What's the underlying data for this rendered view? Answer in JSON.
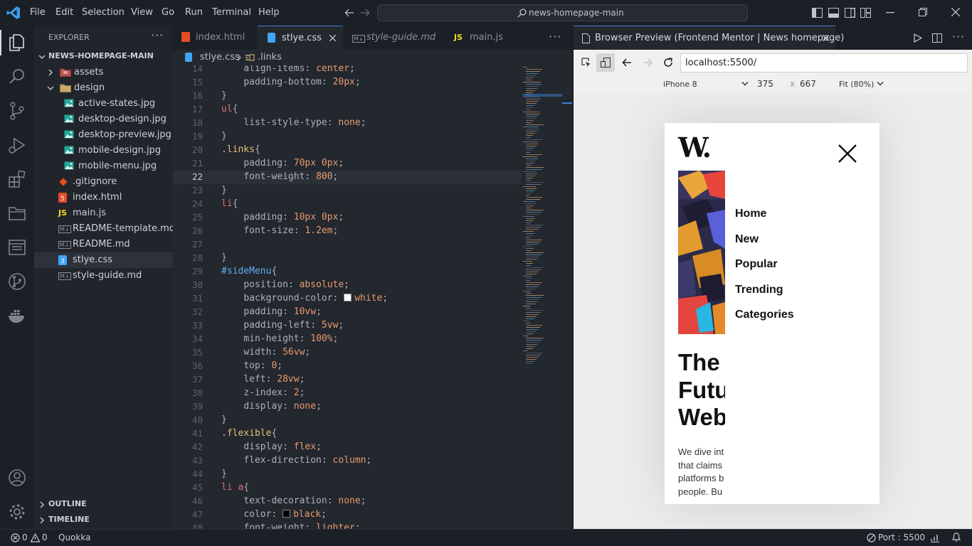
{
  "titlebar": {
    "menu": [
      "File",
      "Edit",
      "Selection",
      "View",
      "Go",
      "Run",
      "Terminal",
      "Help"
    ],
    "search": "news-homepage-main"
  },
  "explorer": {
    "header": "EXPLORER",
    "project": "NEWS-HOMEPAGE-MAIN",
    "items": [
      {
        "label": "assets",
        "icon": "folder-icon"
      },
      {
        "label": "design",
        "icon": "folder-open-icon"
      },
      {
        "label": "active-states.jpg",
        "icon": "image-file-icon"
      },
      {
        "label": "desktop-design.jpg",
        "icon": "image-file-icon"
      },
      {
        "label": "desktop-preview.jpg",
        "icon": "image-file-icon"
      },
      {
        "label": "mobile-design.jpg",
        "icon": "image-file-icon"
      },
      {
        "label": "mobile-menu.jpg",
        "icon": "image-file-icon"
      },
      {
        "label": ".gitignore",
        "icon": "git-file-icon"
      },
      {
        "label": "index.html",
        "icon": "html-file-icon"
      },
      {
        "label": "main.js",
        "icon": "js-file-icon"
      },
      {
        "label": "README-template.md",
        "icon": "markdown-file-icon"
      },
      {
        "label": "README.md",
        "icon": "markdown-file-icon"
      },
      {
        "label": "stlye.css",
        "icon": "css-file-icon"
      },
      {
        "label": "style-guide.md",
        "icon": "markdown-file-icon"
      }
    ],
    "outline": "OUTLINE",
    "timeline": "TIMELINE"
  },
  "editor": {
    "tabs": [
      "index.html",
      "stlye.css",
      "style-guide.md",
      "main.js"
    ],
    "breadcrumb": {
      "file": "stlye.css",
      "symbol": ".links"
    },
    "current_line": 22,
    "lines": [
      {
        "n": 14,
        "tokens": [
          [
            "    ",
            ""
          ],
          [
            "align-items",
            "p"
          ],
          [
            ": ",
            ""
          ],
          [
            "center",
            "v"
          ],
          [
            ";",
            ""
          ]
        ]
      },
      {
        "n": 15,
        "tokens": [
          [
            "    ",
            ""
          ],
          [
            "padding-bottom",
            "p"
          ],
          [
            ": ",
            ""
          ],
          [
            "20px",
            "v"
          ],
          [
            ";",
            ""
          ]
        ]
      },
      {
        "n": 16,
        "tokens": [
          [
            "}",
            ""
          ]
        ]
      },
      {
        "n": 17,
        "tokens": [
          [
            "ul",
            "t"
          ],
          [
            "{",
            ""
          ]
        ]
      },
      {
        "n": 18,
        "tokens": [
          [
            "    ",
            ""
          ],
          [
            "list-style-type",
            "p"
          ],
          [
            ": ",
            ""
          ],
          [
            "none",
            "v"
          ],
          [
            ";",
            ""
          ]
        ]
      },
      {
        "n": 19,
        "tokens": [
          [
            "}",
            ""
          ]
        ]
      },
      {
        "n": 20,
        "tokens": [
          [
            ".links",
            "s"
          ],
          [
            "{",
            ""
          ]
        ]
      },
      {
        "n": 21,
        "tokens": [
          [
            "    ",
            ""
          ],
          [
            "padding",
            "p"
          ],
          [
            ": ",
            ""
          ],
          [
            "70px 0px",
            "v"
          ],
          [
            ";",
            ""
          ]
        ]
      },
      {
        "n": 22,
        "tokens": [
          [
            "    ",
            ""
          ],
          [
            "font-weight",
            "p"
          ],
          [
            ": ",
            ""
          ],
          [
            "800",
            "v"
          ],
          [
            ";",
            ""
          ]
        ]
      },
      {
        "n": 23,
        "tokens": [
          [
            "}",
            ""
          ]
        ]
      },
      {
        "n": 24,
        "tokens": [
          [
            "li",
            "t"
          ],
          [
            "{",
            ""
          ]
        ]
      },
      {
        "n": 25,
        "tokens": [
          [
            "    ",
            ""
          ],
          [
            "padding",
            "p"
          ],
          [
            ": ",
            ""
          ],
          [
            "10px 0px",
            "v"
          ],
          [
            ";",
            ""
          ]
        ]
      },
      {
        "n": 26,
        "tokens": [
          [
            "    ",
            ""
          ],
          [
            "font-size",
            "p"
          ],
          [
            ": ",
            ""
          ],
          [
            "1.2em",
            "v"
          ],
          [
            ";",
            ""
          ]
        ]
      },
      {
        "n": 27,
        "tokens": []
      },
      {
        "n": 28,
        "tokens": [
          [
            "}",
            ""
          ]
        ]
      },
      {
        "n": 29,
        "tokens": [
          [
            "#sideMenu",
            "i"
          ],
          [
            "{",
            ""
          ]
        ]
      },
      {
        "n": 30,
        "tokens": [
          [
            "    ",
            ""
          ],
          [
            "position",
            "p"
          ],
          [
            ": ",
            ""
          ],
          [
            "absolute",
            "v"
          ],
          [
            ";",
            ""
          ]
        ]
      },
      {
        "n": 31,
        "tokens": [
          [
            "    ",
            ""
          ],
          [
            "background-color",
            "p"
          ],
          [
            ": ",
            ""
          ],
          [
            "#white",
            "w"
          ],
          [
            "white",
            "v"
          ],
          [
            ";",
            ""
          ]
        ]
      },
      {
        "n": 32,
        "tokens": [
          [
            "    ",
            ""
          ],
          [
            "padding",
            "p"
          ],
          [
            ": ",
            ""
          ],
          [
            "10vw",
            "v"
          ],
          [
            ";",
            ""
          ]
        ]
      },
      {
        "n": 33,
        "tokens": [
          [
            "    ",
            ""
          ],
          [
            "padding-left",
            "p"
          ],
          [
            ": ",
            ""
          ],
          [
            "5vw",
            "v"
          ],
          [
            ";",
            ""
          ]
        ]
      },
      {
        "n": 34,
        "tokens": [
          [
            "    ",
            ""
          ],
          [
            "min-height",
            "p"
          ],
          [
            ": ",
            ""
          ],
          [
            "100%",
            "v"
          ],
          [
            ";",
            ""
          ]
        ]
      },
      {
        "n": 35,
        "tokens": [
          [
            "    ",
            ""
          ],
          [
            "width",
            "p"
          ],
          [
            ": ",
            ""
          ],
          [
            "56vw",
            "v"
          ],
          [
            ";",
            ""
          ]
        ]
      },
      {
        "n": 36,
        "tokens": [
          [
            "    ",
            ""
          ],
          [
            "top",
            "p"
          ],
          [
            ": ",
            ""
          ],
          [
            "0",
            "v"
          ],
          [
            ";",
            ""
          ]
        ]
      },
      {
        "n": 37,
        "tokens": [
          [
            "    ",
            ""
          ],
          [
            "left",
            "p"
          ],
          [
            ": ",
            ""
          ],
          [
            "28vw",
            "v"
          ],
          [
            ";",
            ""
          ]
        ]
      },
      {
        "n": 38,
        "tokens": [
          [
            "    ",
            ""
          ],
          [
            "z-index",
            "p"
          ],
          [
            ": ",
            ""
          ],
          [
            "2",
            "v"
          ],
          [
            ";",
            ""
          ]
        ]
      },
      {
        "n": 39,
        "tokens": [
          [
            "    ",
            ""
          ],
          [
            "display",
            "p"
          ],
          [
            ": ",
            ""
          ],
          [
            "none",
            "v"
          ],
          [
            ";",
            ""
          ]
        ]
      },
      {
        "n": 40,
        "tokens": [
          [
            "}",
            ""
          ]
        ]
      },
      {
        "n": 41,
        "tokens": [
          [
            ".flexible",
            "s"
          ],
          [
            "{",
            ""
          ]
        ]
      },
      {
        "n": 42,
        "tokens": [
          [
            "    ",
            ""
          ],
          [
            "display",
            "p"
          ],
          [
            ": ",
            ""
          ],
          [
            "flex",
            "v"
          ],
          [
            ";",
            ""
          ]
        ]
      },
      {
        "n": 43,
        "tokens": [
          [
            "    ",
            ""
          ],
          [
            "flex-direction",
            "p"
          ],
          [
            ": ",
            ""
          ],
          [
            "column",
            "v"
          ],
          [
            ";",
            ""
          ]
        ]
      },
      {
        "n": 44,
        "tokens": [
          [
            "}",
            ""
          ]
        ]
      },
      {
        "n": 45,
        "tokens": [
          [
            "li a",
            "t"
          ],
          [
            "{",
            ""
          ]
        ]
      },
      {
        "n": 46,
        "tokens": [
          [
            "    ",
            ""
          ],
          [
            "text-decoration",
            "p"
          ],
          [
            ": ",
            ""
          ],
          [
            "none",
            "v"
          ],
          [
            ";",
            ""
          ]
        ]
      },
      {
        "n": 47,
        "tokens": [
          [
            "    ",
            ""
          ],
          [
            "color",
            "p"
          ],
          [
            ": ",
            ""
          ],
          [
            "#black",
            "k"
          ],
          [
            "black",
            "v"
          ],
          [
            ";",
            ""
          ]
        ]
      },
      {
        "n": 48,
        "tokens": [
          [
            "    ",
            ""
          ],
          [
            "font-weight",
            "p"
          ],
          [
            ": ",
            ""
          ],
          [
            "lighter",
            "v"
          ],
          [
            ";",
            ""
          ]
        ]
      }
    ]
  },
  "preview": {
    "tab_title": "Browser Preview (Frontend Mentor | News homepage)",
    "url": "localhost:5500/",
    "device": "iPhone 8",
    "width": "375",
    "times": "x",
    "height": "667",
    "zoom": "Fit (80%)",
    "site": {
      "logo": "W.",
      "menu": [
        "Home",
        "New",
        "Popular",
        "Trending",
        "Categories"
      ],
      "headline": [
        "The",
        "Futu",
        "Web"
      ],
      "body": [
        "We dive int",
        "that claims",
        "platforms b",
        "people. Bu"
      ]
    }
  },
  "statusbar": {
    "errors": "0",
    "warnings": "0",
    "quokka": "Quokka",
    "port": "Port : 5500"
  },
  "colors": {
    "accent": "#3e80d6",
    "selector": "#e5c07b",
    "value": "#e79b6f"
  }
}
